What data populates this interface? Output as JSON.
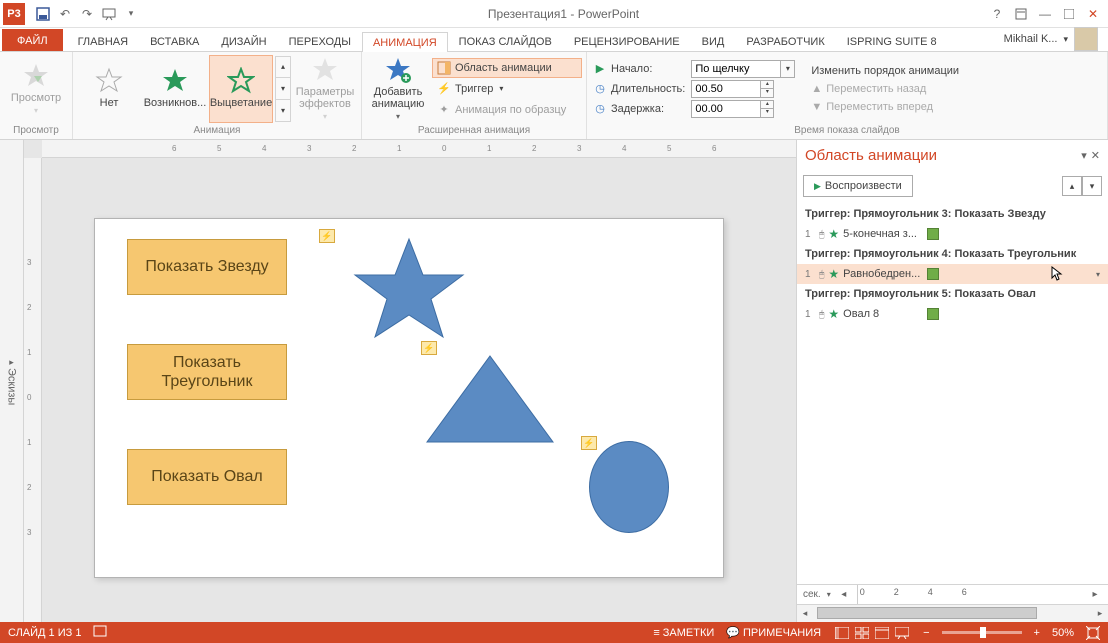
{
  "titlebar": {
    "title": "Презентация1 - PowerPoint",
    "app_icon_text": "P3"
  },
  "tabs": {
    "file": "ФАЙЛ",
    "items": [
      "ГЛАВНАЯ",
      "ВСТАВКА",
      "ДИЗАЙН",
      "ПЕРЕХОДЫ",
      "АНИМАЦИЯ",
      "ПОКАЗ СЛАЙДОВ",
      "РЕЦЕНЗИРОВАНИЕ",
      "ВИД",
      "РАЗРАБОТЧИК",
      "ISPRING SUITE 8"
    ],
    "active_index": 4,
    "user": "Mikhail K..."
  },
  "ribbon": {
    "preview_group_label": "Просмотр",
    "preview_btn": "Просмотр",
    "anim_group_label": "Анимация",
    "effects": {
      "none": "Нет",
      "appear": "Возникнов...",
      "fade": "Выцветание"
    },
    "params": "Параметры эффектов",
    "addanim": "Добавить анимацию",
    "ext_group_label": "Расширенная анимация",
    "anim_pane_btn": "Область анимации",
    "trigger_btn": "Триггер",
    "painter_btn": "Анимация по образцу",
    "timing_group_label": "Время показа слайдов",
    "start_label": "Начало:",
    "start_value": "По щелчку",
    "duration_label": "Длительность:",
    "duration_value": "00.50",
    "delay_label": "Задержка:",
    "delay_value": "00.00",
    "reorder_label": "Изменить порядок анимации",
    "move_back": "Переместить назад",
    "move_fwd": "Переместить вперед"
  },
  "thumb_strip": "Эскизы",
  "slide": {
    "btn1": "Показать Звезду",
    "btn2": "Показать Треугольник",
    "btn3": "Показать Овал"
  },
  "anim_pane": {
    "title": "Область анимации",
    "play": "Воспроизвести",
    "trig1": "Триггер: Прямоугольник 3: Показать Звезду",
    "item1": "5-конечная з...",
    "trig2": "Триггер: Прямоугольник 4: Показать Треугольник",
    "item2": "Равнобедрен...",
    "trig3": "Триггер: Прямоугольник 5: Показать Овал",
    "item3": "Овал 8",
    "sec_label": "сек."
  },
  "status": {
    "slide": "СЛАЙД 1 ИЗ 1",
    "notes": "ЗАМЕТКИ",
    "comments": "ПРИМЕЧАНИЯ",
    "zoom": "50%"
  }
}
